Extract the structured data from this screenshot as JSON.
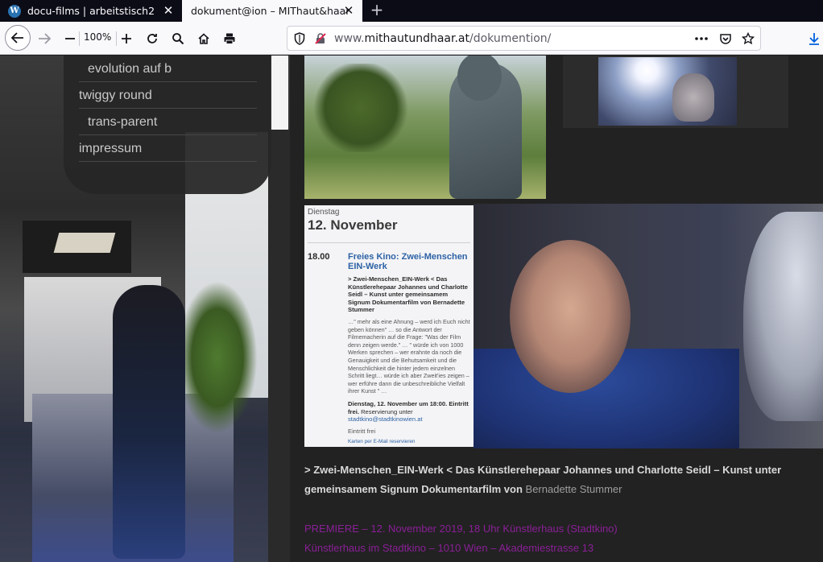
{
  "browser": {
    "tabs": [
      {
        "title": "docu-films | arbeitstisch2",
        "active": false
      },
      {
        "title": "dokument@ion – MIThaut&haar",
        "active": true
      }
    ],
    "zoom": "100%",
    "url": {
      "prefix": "www.",
      "domain": "mithautundhaar.at",
      "path": "/dokumention/"
    },
    "accent_color": "#0060df"
  },
  "nav_menu": {
    "items": [
      {
        "label": "evolution auf b",
        "level": "sub"
      },
      {
        "label": "twiggy round",
        "level": "top"
      },
      {
        "label": "trans-parent",
        "level": "sub"
      },
      {
        "label": "impressum",
        "level": "top"
      }
    ]
  },
  "flyer": {
    "day": "Dienstag",
    "date": "12. November",
    "time": "18.00",
    "headline": "Freies Kino: Zwei-Menschen EIN-Werk",
    "subhead": "> Zwei-Menschen_EIN-Werk < Das Künstlerehepaar Johannes und Charlotte Seidl – Kunst unter gemeinsamem Signum Dokumentarfilm von Bernadette Stummer",
    "body": "…\" mehr als eine Ahnung – werd ich Euch nicht geben können\" … so die Antwort der Filmemacherin auf die Frage: \"Was der Film denn zeigen werde.\" … \" würde ich von 1000 Werken sprechen – wer erahnte da noch die Genauigkeit und die Behutsamkeit und die Menschlichkeit die hinter jedem einzelnen Schritt liegt… würde ich aber Zweit'ies zeigen – wer erführe dann die unbeschreibliche Vielfalt ihrer Kunst \" …",
    "when_bold": "Dienstag, 12. November um 18:00. Eintritt frei.",
    "when_rest": "Reservierung unter",
    "email": "stadtkino@stadtkinowien.at",
    "free": "Eintritt frei",
    "reserve": "Karten per E-Mail reservieren"
  },
  "caption": {
    "text": "> Zwei-Menschen_EIN-Werk < Das Künstlerehepaar Johannes und Charlotte Seidl – Kunst unter gemeinsamem Signum Dokumentarfilm von",
    "author": "Bernadette Stummer"
  },
  "premiere": {
    "line1": "PREMIERE – 12. November 2019, 18 Uhr Künstlerhaus (Stadtkino)",
    "line2": "Künstlerhaus im Stadtkino – 1010 Wien – Akademiestrasse 13",
    "color": "#8a1f97"
  },
  "icons": [
    "wordpress-icon",
    "close-icon",
    "plus-icon",
    "back-arrow-icon",
    "forward-arrow-icon",
    "zoom-out-icon",
    "zoom-in-icon",
    "reload-icon",
    "search-icon",
    "home-icon",
    "print-icon",
    "shield-icon",
    "insecure-lock-icon",
    "more-icon",
    "pocket-icon",
    "star-icon",
    "download-icon"
  ]
}
